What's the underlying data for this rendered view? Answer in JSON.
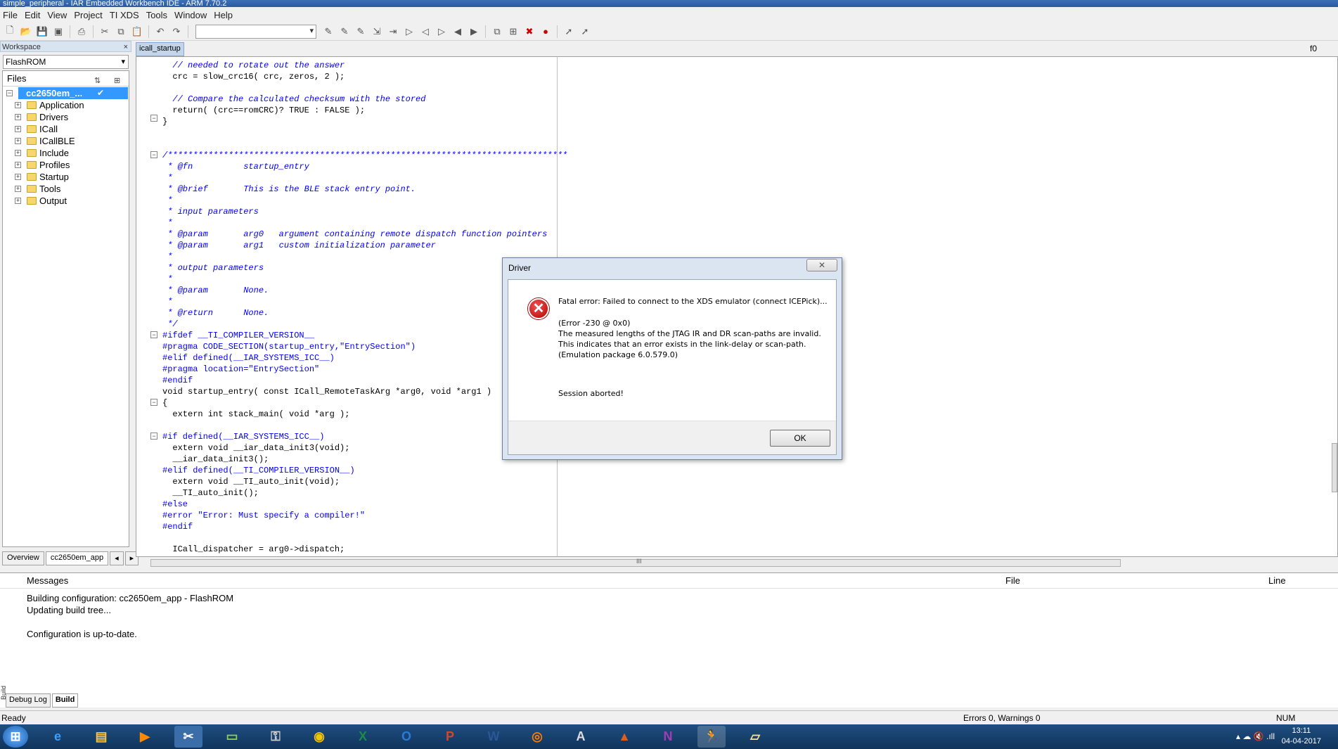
{
  "window": {
    "title": "simple_peripheral - IAR Embedded Workbench IDE - ARM 7.70.2"
  },
  "menu": [
    "File",
    "Edit",
    "View",
    "Project",
    "TI XDS",
    "Tools",
    "Window",
    "Help"
  ],
  "workspace": {
    "header": "Workspace",
    "close": "×",
    "config": "FlashROM",
    "files_header": "Files",
    "root": {
      "label": "cc2650em_...",
      "check": "✔"
    },
    "folders": [
      "Application",
      "Drivers",
      "ICall",
      "ICallBLE",
      "Include",
      "Profiles",
      "Startup",
      "Tools",
      "Output"
    ],
    "tabs": [
      "Overview",
      "cc2650em_app"
    ]
  },
  "editor": {
    "tab": "icall_startup",
    "function": "f0",
    "code_lines": [
      {
        "t": "  // needed to rotate out the answer",
        "k": "c"
      },
      {
        "t": "  crc = slow_crc16( crc, zeros, 2 );",
        "k": "s"
      },
      {
        "t": "",
        "k": "s"
      },
      {
        "t": "  // Compare the calculated checksum with the stored",
        "k": "c"
      },
      {
        "t": "  return( (crc==romCRC)? TRUE : FALSE );",
        "k": "s"
      },
      {
        "t": "}",
        "k": "s"
      },
      {
        "t": "",
        "k": "s"
      },
      {
        "t": "",
        "k": "s"
      },
      {
        "t": "/*******************************************************************************",
        "k": "c"
      },
      {
        "t": " * @fn          startup_entry",
        "k": "c"
      },
      {
        "t": " *",
        "k": "c"
      },
      {
        "t": " * @brief       This is the BLE stack entry point.",
        "k": "c"
      },
      {
        "t": " *",
        "k": "c"
      },
      {
        "t": " * input parameters",
        "k": "c"
      },
      {
        "t": " *",
        "k": "c"
      },
      {
        "t": " * @param       arg0   argument containing remote dispatch function pointers",
        "k": "c"
      },
      {
        "t": " * @param       arg1   custom initialization parameter",
        "k": "c"
      },
      {
        "t": " *",
        "k": "c"
      },
      {
        "t": " * output parameters",
        "k": "c"
      },
      {
        "t": " *",
        "k": "c"
      },
      {
        "t": " * @param       None.",
        "k": "c"
      },
      {
        "t": " *",
        "k": "c"
      },
      {
        "t": " * @return      None.",
        "k": "c"
      },
      {
        "t": " */",
        "k": "c"
      },
      {
        "t": "#ifdef __TI_COMPILER_VERSION__",
        "k": "p"
      },
      {
        "t": "#pragma CODE_SECTION(startup_entry,\"EntrySection\")",
        "k": "p"
      },
      {
        "t": "#elif defined(__IAR_SYSTEMS_ICC__)",
        "k": "p"
      },
      {
        "t": "#pragma location=\"EntrySection\"",
        "k": "p"
      },
      {
        "t": "#endif",
        "k": "p"
      },
      {
        "t": "void startup_entry( const ICall_RemoteTaskArg *arg0, void *arg1 )",
        "k": "s"
      },
      {
        "t": "{",
        "k": "s"
      },
      {
        "t": "  extern int stack_main( void *arg );",
        "k": "s"
      },
      {
        "t": "",
        "k": "s"
      },
      {
        "t": "#if defined(__IAR_SYSTEMS_ICC__)",
        "k": "p"
      },
      {
        "t": "  extern void __iar_data_init3(void);",
        "k": "s"
      },
      {
        "t": "  __iar_data_init3();",
        "k": "s"
      },
      {
        "t": "#elif defined(__TI_COMPILER_VERSION__)",
        "k": "p"
      },
      {
        "t": "  extern void __TI_auto_init(void);",
        "k": "s"
      },
      {
        "t": "  __TI_auto_init();",
        "k": "s"
      },
      {
        "t": "#else",
        "k": "p"
      },
      {
        "t": "#error \"Error: Must specify a compiler!\"",
        "k": "p"
      },
      {
        "t": "#endif",
        "k": "p"
      },
      {
        "t": "",
        "k": "s"
      },
      {
        "t": "  ICall_dispatcher = arg0->dispatch;",
        "k": "s"
      }
    ],
    "hscroll_grip": "III"
  },
  "messages": {
    "headers": {
      "messages": "Messages",
      "file": "File",
      "line": "Line"
    },
    "lines": [
      "Building configuration: cc2650em_app - FlashROM",
      "Updating build tree...",
      "",
      "Configuration is up-to-date."
    ],
    "side_label": "Build",
    "tabs": [
      "Debug Log",
      "Build"
    ]
  },
  "status": {
    "left": "Ready",
    "errors": "Errors 0, Warnings 0",
    "num": "NUM"
  },
  "taskbar": {
    "apps": [
      "IE",
      "Explorer",
      "Media",
      "Tools",
      "Computer",
      "Key",
      "Chrome",
      "Excel",
      "Outlook",
      "PowerPoint",
      "Word",
      "Firefox",
      "App",
      "MATLAB",
      "OneNote",
      "Run",
      "Notes"
    ],
    "time": "13:11",
    "date": "04-04-2017"
  },
  "dialog": {
    "title": "Driver",
    "close": "✕",
    "error_icon": "✕",
    "message": "Fatal error: Failed to connect to the XDS emulator (connect ICEPick)...",
    "detail_lines": [
      "(Error -230 @ 0x0)",
      "The measured lengths of the JTAG IR and DR scan-paths are invalid.",
      "This indicates that an error exists in the link-delay or scan-path.",
      "(Emulation package 6.0.579.0)"
    ],
    "session": "Session aborted!",
    "ok": "OK"
  }
}
